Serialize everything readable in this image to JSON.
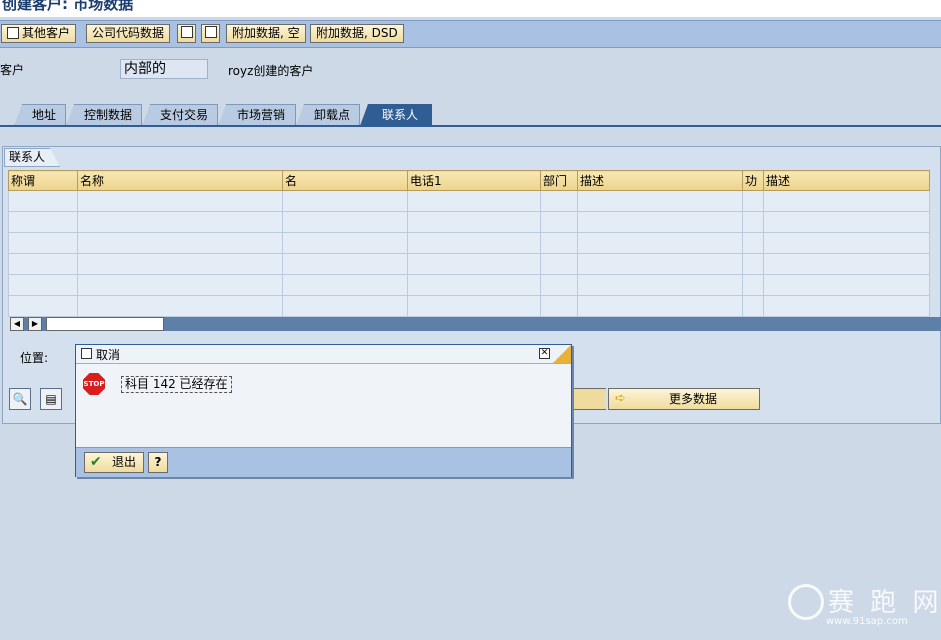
{
  "window": {
    "title": "创建客户: 市场数据"
  },
  "toolbar": {
    "other_customer": "其他客户",
    "company_code_data": "公司代码数据",
    "additional_data_empty": "附加数据, 空",
    "additional_data_dsd": "附加数据, DSD"
  },
  "header": {
    "customer_label": "客户",
    "customer_value": "内部的",
    "customer_desc": "royz创建的客户"
  },
  "tabs": [
    "地址",
    "控制数据",
    "支付交易",
    "市场营销",
    "卸载点",
    "联系人"
  ],
  "active_tab": "联系人",
  "contacts": {
    "group_title": "联系人",
    "columns": [
      "称谓",
      "名称",
      "名",
      "电话1",
      "部门",
      "描述",
      "功",
      "描述"
    ],
    "rows": [
      [
        "",
        "",
        "",
        "",
        "",
        "",
        "",
        ""
      ],
      [
        "",
        "",
        "",
        "",
        "",
        "",
        "",
        ""
      ],
      [
        "",
        "",
        "",
        "",
        "",
        "",
        "",
        ""
      ],
      [
        "",
        "",
        "",
        "",
        "",
        "",
        "",
        ""
      ],
      [
        "",
        "",
        "",
        "",
        "",
        "",
        "",
        ""
      ],
      [
        "",
        "",
        "",
        "",
        "",
        "",
        "",
        ""
      ]
    ]
  },
  "position": {
    "label": "位置:"
  },
  "more_data": "更多数据",
  "dialog": {
    "title": "取消",
    "message": "科目 142 已经存在",
    "stop_icon_text": "STOP",
    "exit_label": "退出",
    "help_symbol": "?"
  },
  "watermark": {
    "name": "赛 跑 网",
    "url": "www.91sap.com"
  },
  "colors": {
    "tab_active": "#2f5d94",
    "toolbar": "#a9c2e3",
    "button": "#efdb9e",
    "stop": "#d81e1e"
  }
}
